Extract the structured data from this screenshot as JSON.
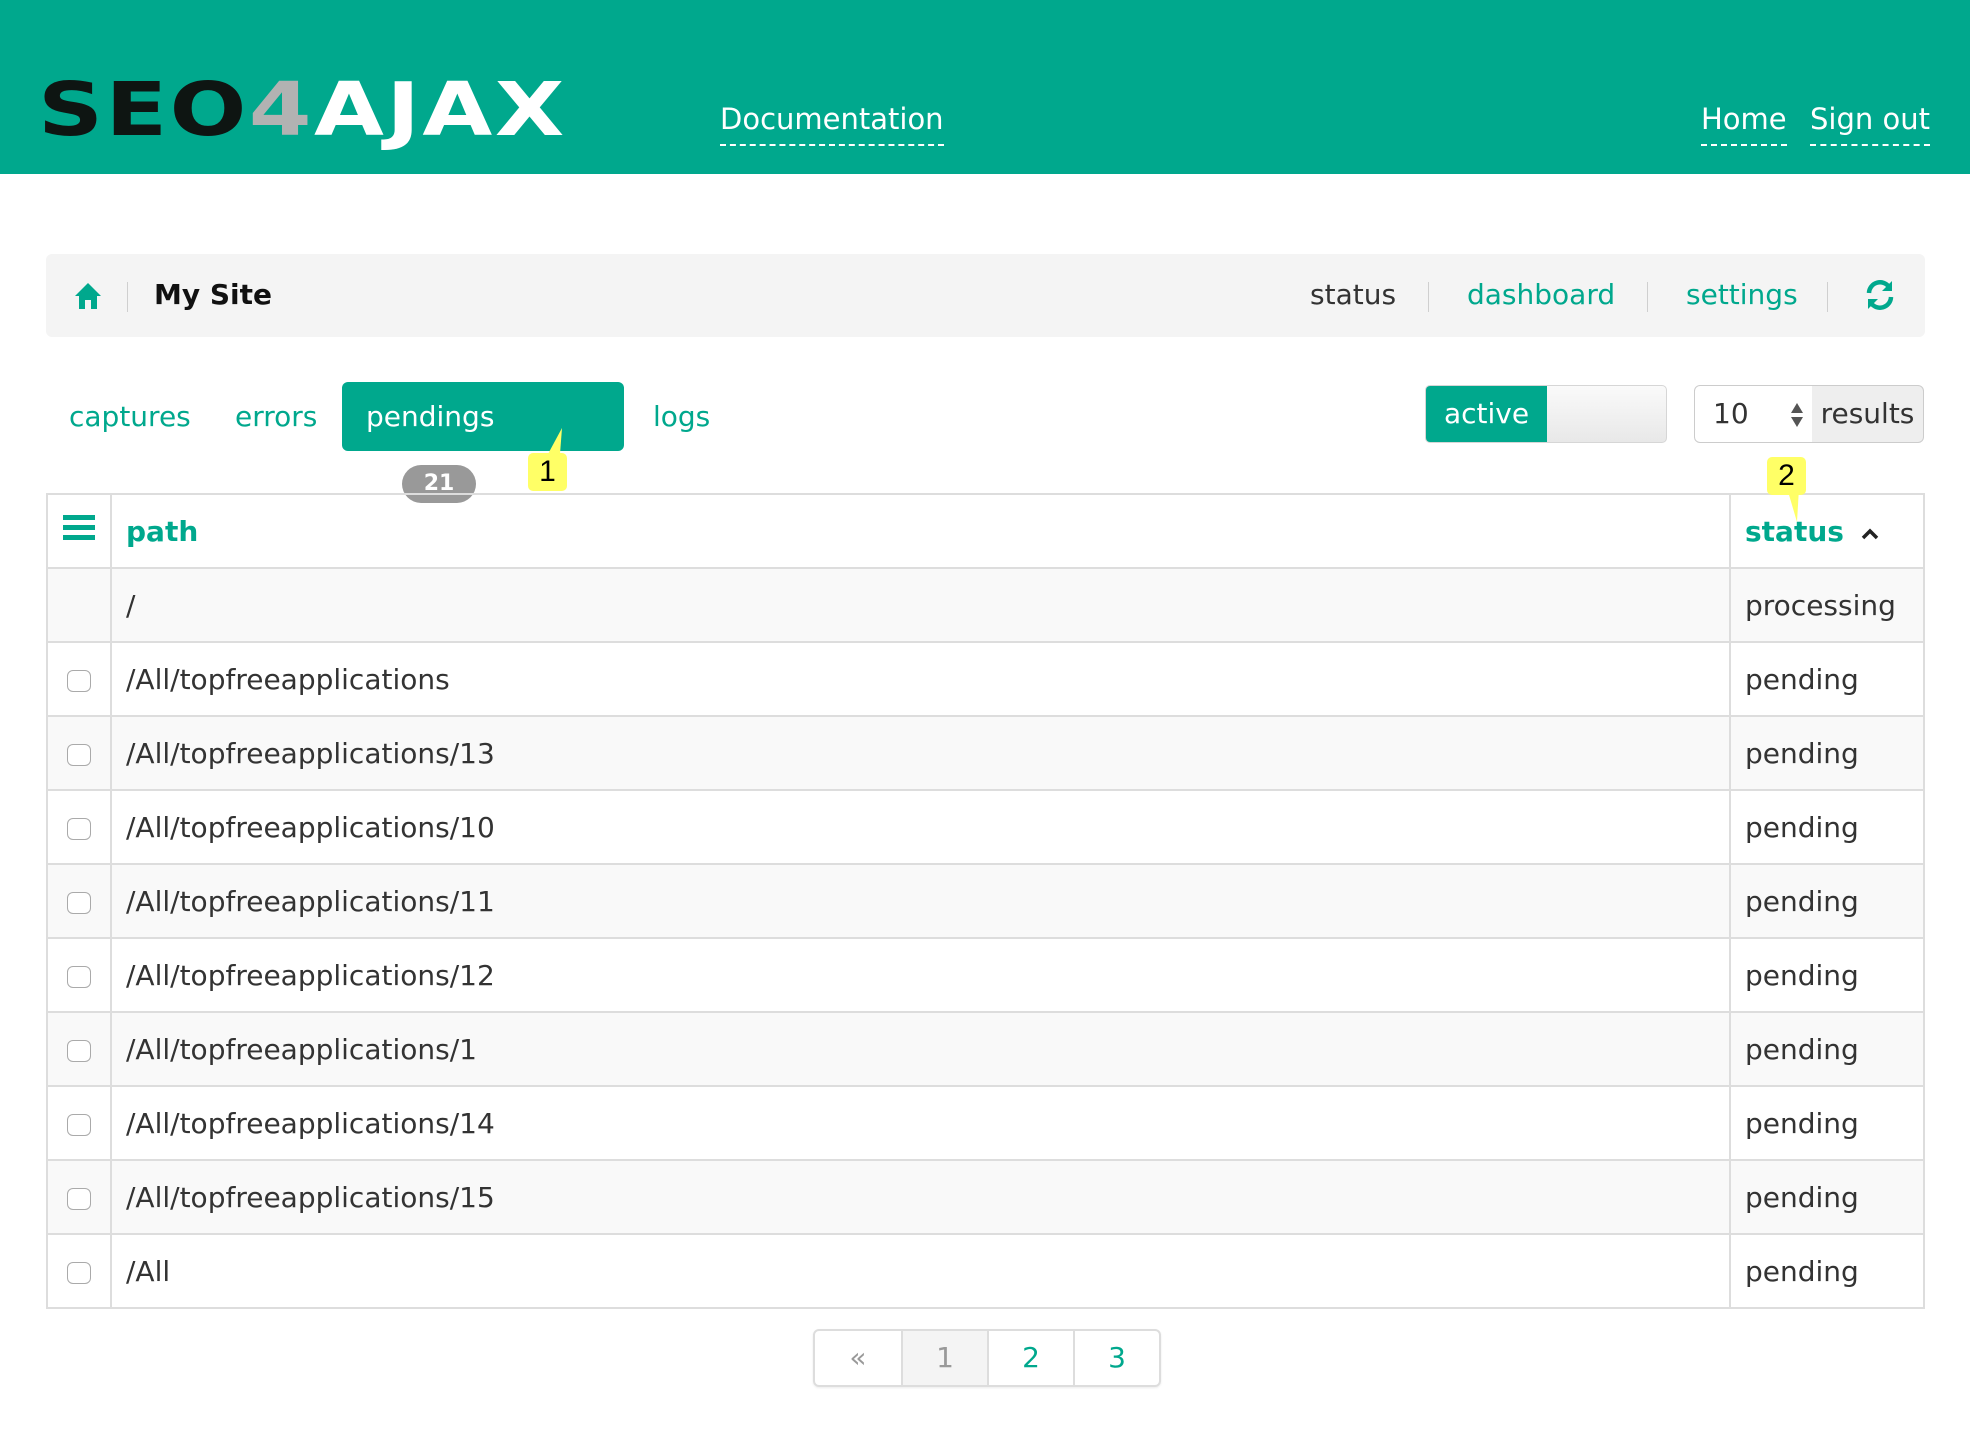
{
  "header": {
    "logo": {
      "part1": "SEO",
      "part2": "4",
      "part3": "AJAX"
    },
    "documentation_link": "Documentation",
    "home_link": "Home",
    "signout_link": "Sign out"
  },
  "breadcrumb": {
    "home_icon": "home-icon",
    "site_name": "My Site",
    "nav": {
      "status": "status",
      "dashboard": "dashboard",
      "settings": "settings"
    },
    "refresh_icon": "refresh-icon"
  },
  "tabs": {
    "captures": "captures",
    "errors": "errors",
    "pendings": "pendings",
    "pendings_count": "21",
    "logs": "logs"
  },
  "controls": {
    "active_toggle_label": "active",
    "per_page_value": "10",
    "results_label": "results"
  },
  "table": {
    "menu_icon": "menu-icon",
    "headers": {
      "path": "path",
      "status": "status"
    },
    "sort_icon": "chevron-up-icon",
    "rows": [
      {
        "path": "/",
        "status": "processing",
        "checkbox": false
      },
      {
        "path": "/All/topfreeapplications",
        "status": "pending",
        "checkbox": true
      },
      {
        "path": "/All/topfreeapplications/13",
        "status": "pending",
        "checkbox": true
      },
      {
        "path": "/All/topfreeapplications/10",
        "status": "pending",
        "checkbox": true
      },
      {
        "path": "/All/topfreeapplications/11",
        "status": "pending",
        "checkbox": true
      },
      {
        "path": "/All/topfreeapplications/12",
        "status": "pending",
        "checkbox": true
      },
      {
        "path": "/All/topfreeapplications/1",
        "status": "pending",
        "checkbox": true
      },
      {
        "path": "/All/topfreeapplications/14",
        "status": "pending",
        "checkbox": true
      },
      {
        "path": "/All/topfreeapplications/15",
        "status": "pending",
        "checkbox": true
      },
      {
        "path": "/All",
        "status": "pending",
        "checkbox": true
      }
    ]
  },
  "pagination": {
    "prev": "«",
    "pages": [
      "1",
      "2",
      "3"
    ],
    "current": "1"
  },
  "annotations": {
    "callout1": "1",
    "callout2": "2"
  },
  "colors": {
    "brand": "#00a88d",
    "callout": "#ffff66"
  }
}
